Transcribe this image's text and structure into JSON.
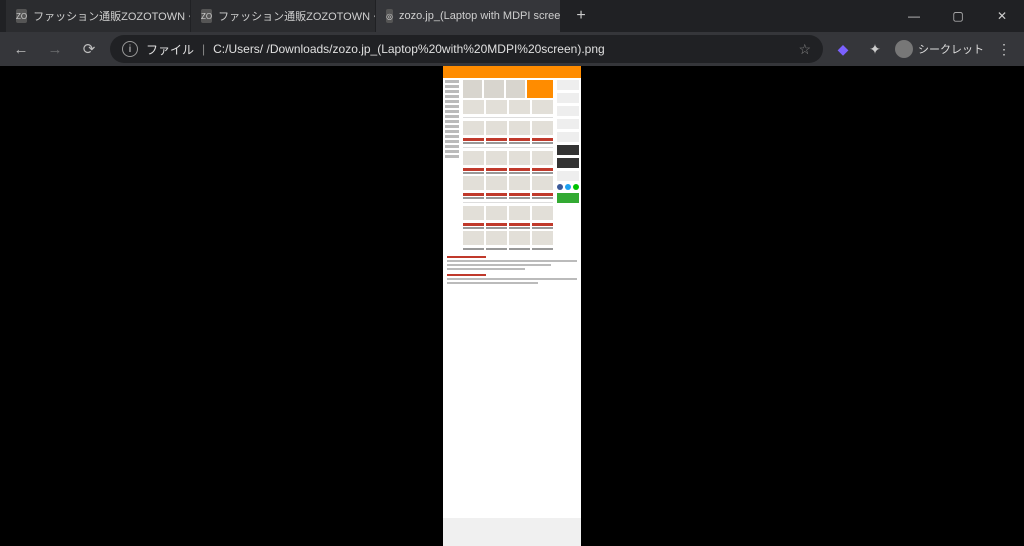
{
  "tabs": [
    {
      "favicon": "ZO",
      "title": "ファッション通販ZOZOTOWN・セール"
    },
    {
      "favicon": "ZO",
      "title": "ファッション通販ZOZOTOWN・セール"
    },
    {
      "favicon": "◎",
      "title": "zozo.jp_(Laptop with MDPI scree",
      "active": true
    }
  ],
  "toolbar": {
    "file_label": "ファイル",
    "url": "C:/Users/           /Downloads/zozo.jp_(Laptop%20with%20MDPI%20screen).png",
    "incognito_label": "シークレット"
  }
}
